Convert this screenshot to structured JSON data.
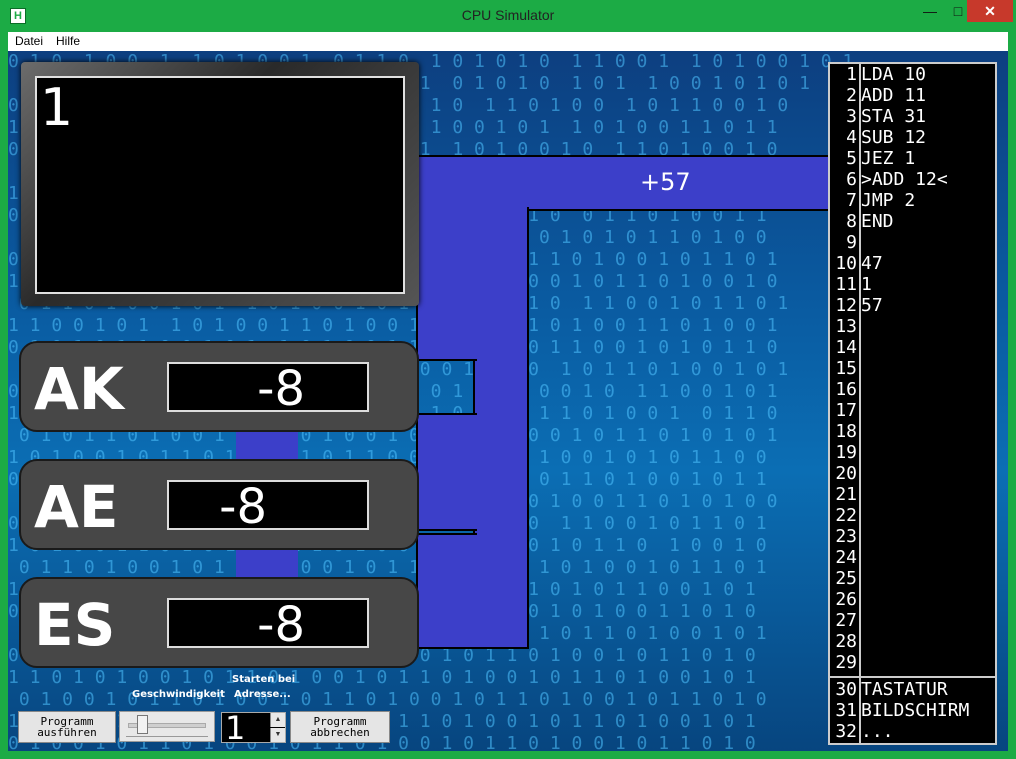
{
  "window": {
    "title": "CPU Simulator",
    "icon": "H"
  },
  "menu": [
    "Datei",
    "Hilfe"
  ],
  "screen": {
    "text": "1"
  },
  "bus": {
    "label": "+57"
  },
  "registers": [
    {
      "name": "AK",
      "value": "-8"
    },
    {
      "name": "AE",
      "value": "-8"
    },
    {
      "name": "ES",
      "value": "-8"
    }
  ],
  "controls": {
    "speed_label": "Geschwindigkeit",
    "start_label_1": "Starten bei",
    "start_label_2": "Adresse...",
    "run_1": "Programm",
    "run_2": "ausführen",
    "abort_1": "Programm",
    "abort_2": "abbrechen",
    "start_address": "1"
  },
  "memory": [
    {
      "addr": "1",
      "value": "LDA 10"
    },
    {
      "addr": "2",
      "value": "ADD 11"
    },
    {
      "addr": "3",
      "value": "STA 31"
    },
    {
      "addr": "4",
      "value": "SUB 12"
    },
    {
      "addr": "5",
      "value": "JEZ 1"
    },
    {
      "addr": "6",
      "value": ">ADD 12<"
    },
    {
      "addr": "7",
      "value": "JMP 2"
    },
    {
      "addr": "8",
      "value": "END"
    },
    {
      "addr": "9",
      "value": ""
    },
    {
      "addr": "10",
      "value": "47"
    },
    {
      "addr": "11",
      "value": "1"
    },
    {
      "addr": "12",
      "value": "57"
    },
    {
      "addr": "13",
      "value": ""
    },
    {
      "addr": "14",
      "value": ""
    },
    {
      "addr": "15",
      "value": ""
    },
    {
      "addr": "16",
      "value": ""
    },
    {
      "addr": "17",
      "value": ""
    },
    {
      "addr": "18",
      "value": ""
    },
    {
      "addr": "19",
      "value": ""
    },
    {
      "addr": "20",
      "value": ""
    },
    {
      "addr": "21",
      "value": ""
    },
    {
      "addr": "22",
      "value": ""
    },
    {
      "addr": "23",
      "value": ""
    },
    {
      "addr": "24",
      "value": ""
    },
    {
      "addr": "25",
      "value": ""
    },
    {
      "addr": "26",
      "value": ""
    },
    {
      "addr": "27",
      "value": ""
    },
    {
      "addr": "28",
      "value": ""
    },
    {
      "addr": "29",
      "value": ""
    },
    {
      "addr": "30",
      "value": "TASTATUR"
    },
    {
      "addr": "31",
      "value": "BILDSCHIRM"
    },
    {
      "addr": "32",
      "value": "..."
    }
  ]
}
